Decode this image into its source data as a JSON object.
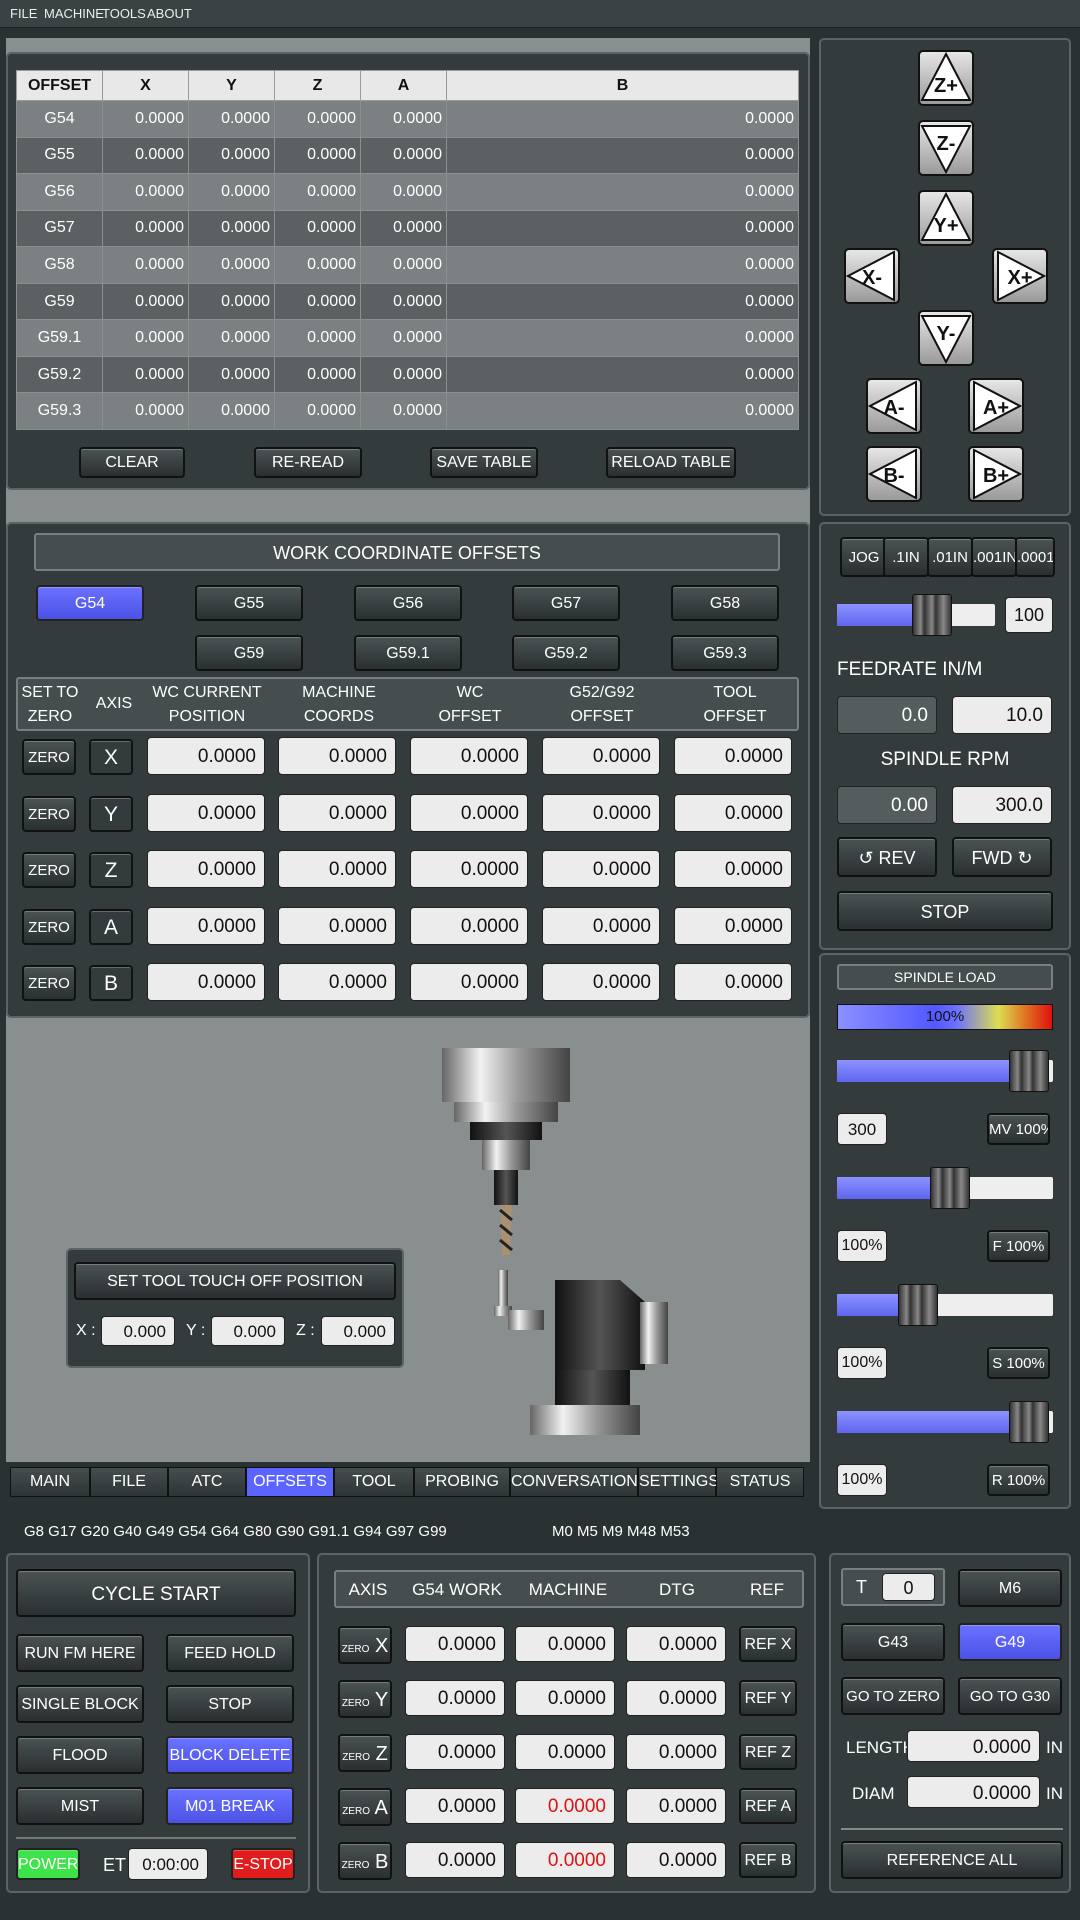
{
  "menu": [
    "FILE",
    "MACHINE",
    "TOOLS",
    "ABOUT"
  ],
  "offset_table": {
    "headers": [
      "OFFSET",
      "X",
      "Y",
      "Z",
      "A",
      "B"
    ],
    "rows": [
      [
        "G54",
        "0.0000",
        "0.0000",
        "0.0000",
        "0.0000",
        "0.0000"
      ],
      [
        "G55",
        "0.0000",
        "0.0000",
        "0.0000",
        "0.0000",
        "0.0000"
      ],
      [
        "G56",
        "0.0000",
        "0.0000",
        "0.0000",
        "0.0000",
        "0.0000"
      ],
      [
        "G57",
        "0.0000",
        "0.0000",
        "0.0000",
        "0.0000",
        "0.0000"
      ],
      [
        "G58",
        "0.0000",
        "0.0000",
        "0.0000",
        "0.0000",
        "0.0000"
      ],
      [
        "G59",
        "0.0000",
        "0.0000",
        "0.0000",
        "0.0000",
        "0.0000"
      ],
      [
        "G59.1",
        "0.0000",
        "0.0000",
        "0.0000",
        "0.0000",
        "0.0000"
      ],
      [
        "G59.2",
        "0.0000",
        "0.0000",
        "0.0000",
        "0.0000",
        "0.0000"
      ],
      [
        "G59.3",
        "0.0000",
        "0.0000",
        "0.0000",
        "0.0000",
        "0.0000"
      ]
    ],
    "buttons": [
      "CLEAR",
      "RE-READ",
      "SAVE TABLE",
      "RELOAD TABLE"
    ]
  },
  "jog_arrows": {
    "zp": "Z+",
    "zm": "Z-",
    "yp": "Y+",
    "ym": "Y-",
    "xm": "X-",
    "xp": "X+",
    "am": "A-",
    "ap": "A+",
    "bm": "B-",
    "bp": "B+"
  },
  "wco": {
    "title": "WORK COORDINATE OFFSETS",
    "selectors": [
      "G54",
      "G55",
      "G56",
      "G57",
      "G58",
      "G59",
      "G59.1",
      "G59.2",
      "G59.3"
    ],
    "active": "G54",
    "headers": [
      "SET TO\nZERO",
      "AXIS",
      "WC CURRENT\nPOSITION",
      "MACHINE\nCOORDS",
      "WC\nOFFSET",
      "G52/G92\nOFFSET",
      "TOOL\nOFFSET"
    ],
    "zero_label": "ZERO",
    "rows": [
      {
        "axis": "X",
        "vals": [
          "0.0000",
          "0.0000",
          "0.0000",
          "0.0000",
          "0.0000"
        ]
      },
      {
        "axis": "Y",
        "vals": [
          "0.0000",
          "0.0000",
          "0.0000",
          "0.0000",
          "0.0000"
        ]
      },
      {
        "axis": "Z",
        "vals": [
          "0.0000",
          "0.0000",
          "0.0000",
          "0.0000",
          "0.0000"
        ]
      },
      {
        "axis": "A",
        "vals": [
          "0.0000",
          "0.0000",
          "0.0000",
          "0.0000",
          "0.0000"
        ]
      },
      {
        "axis": "B",
        "vals": [
          "0.0000",
          "0.0000",
          "0.0000",
          "0.0000",
          "0.0000"
        ]
      }
    ]
  },
  "jog": {
    "increments": [
      "JOG",
      ".1IN",
      ".01IN",
      ".001IN",
      ".0001"
    ],
    "value": "100",
    "slider_level": 0.5,
    "feed_label": "FEEDRATE IN/M",
    "feed_actual": "0.0",
    "feed_set": "10.0",
    "spindle_label": "SPINDLE RPM",
    "spindle_actual": "0.00",
    "spindle_set": "300.0",
    "rev": "REV",
    "fwd": "FWD",
    "stop": "STOP"
  },
  "load": {
    "title": "SPINDLE LOAD",
    "pct": "100%",
    "s1_level": 0.85,
    "max_val": "300",
    "mv": "MV 100%",
    "s2_level": 0.45,
    "f_val": "100%",
    "f_btn": "F 100%",
    "s3_level": 0.3,
    "s_val": "100%",
    "s_btn": "S 100%",
    "s4_level": 0.85,
    "r_val": "100%",
    "r_btn": "R 100%"
  },
  "touch": {
    "title": "SET TOOL TOUCH OFF POSITION",
    "x_label": "X :",
    "x": "0.000",
    "y_label": "Y :",
    "y": "0.000",
    "z_label": "Z :",
    "z": "0.000"
  },
  "tabs": [
    "MAIN",
    "FILE",
    "ATC",
    "OFFSETS",
    "TOOL",
    "PROBING",
    "CONVERSATIONAL",
    "SETTINGS",
    "STATUS"
  ],
  "active_tab": "OFFSETS",
  "gcodes": "G8 G17 G20 G40 G49 G54 G64 G80 G90 G91.1 G94 G97 G99",
  "mcodes": "M0 M5 M9 M48 M53",
  "control": {
    "cycle_start": "CYCLE START",
    "run_here": "RUN FM HERE",
    "feed_hold": "FEED HOLD",
    "single_block": "SINGLE BLOCK",
    "stop": "STOP",
    "flood": "FLOOD",
    "block_delete": "BLOCK DELETE",
    "mist": "MIST",
    "m01": "M01 BREAK",
    "power": "POWER",
    "et_label": "ET",
    "et": "0:00:00",
    "estop": "E-STOP"
  },
  "dro": {
    "headers": [
      "AXIS",
      "G54 WORK",
      "MACHINE",
      "DTG",
      "REF"
    ],
    "zero": "ZERO",
    "rows": [
      {
        "axis": "X",
        "work": "0.0000",
        "mach": "0.0000",
        "dtg": "0.0000",
        "ref": "REF X"
      },
      {
        "axis": "Y",
        "work": "0.0000",
        "mach": "0.0000",
        "dtg": "0.0000",
        "ref": "REF Y"
      },
      {
        "axis": "Z",
        "work": "0.0000",
        "mach": "0.0000",
        "dtg": "0.0000",
        "ref": "REF Z"
      },
      {
        "axis": "A",
        "work": "0.0000",
        "mach": "0.0000",
        "dtg": "0.0000",
        "ref": "REF A"
      },
      {
        "axis": "B",
        "work": "0.0000",
        "mach": "0.0000",
        "dtg": "0.0000",
        "ref": "REF B"
      }
    ]
  },
  "tool": {
    "t_label": "T",
    "t_val": "0",
    "m6": "M6",
    "g43": "G43",
    "g49": "G49",
    "goto_zero": "GO TO ZERO",
    "goto_g30": "GO TO G30",
    "length_label": "LENGTH",
    "length": "0.0000",
    "diam_label": "DIAM",
    "diam": "0.0000",
    "unit": "IN",
    "ref_all": "REFERENCE ALL"
  },
  "colors": {
    "accent": "#5c64ff",
    "bg": "#2a3132",
    "panel": "#333b3d",
    "power": "#3ee24a",
    "estop": "#e01c1c"
  }
}
